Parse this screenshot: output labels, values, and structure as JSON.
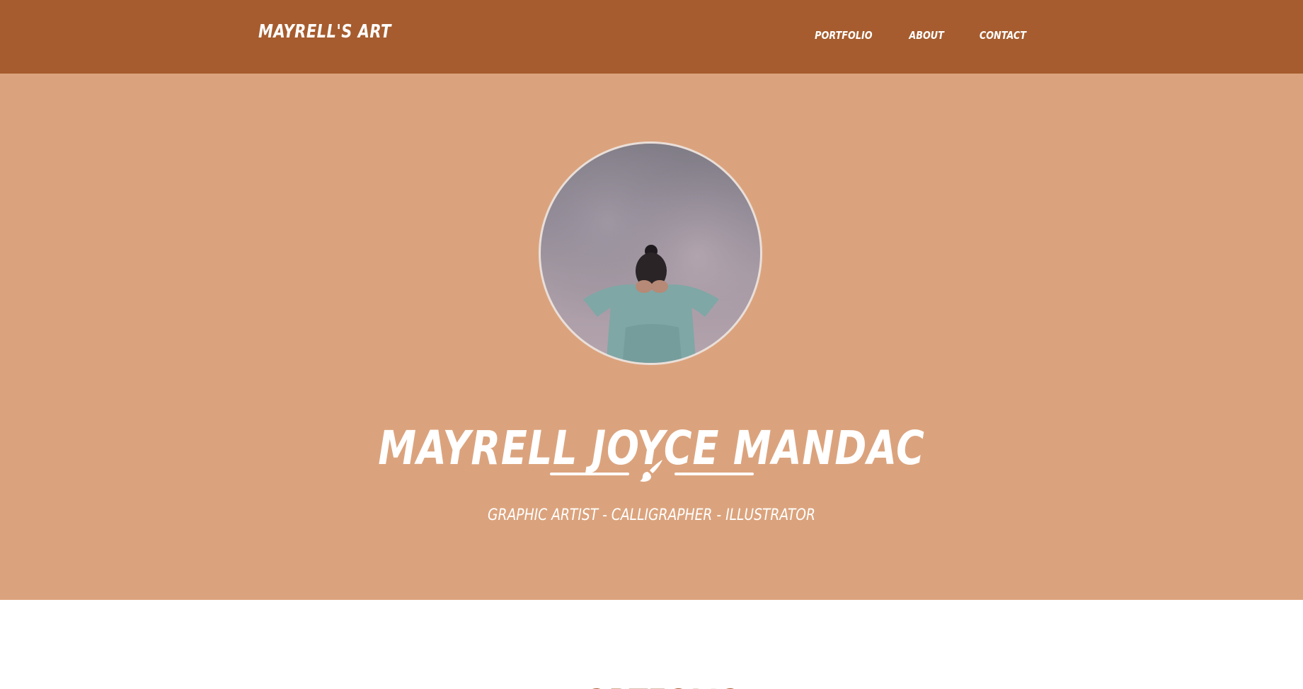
{
  "navbar": {
    "brand": "MAYRELL'S ART",
    "links": [
      "PORTFOLIO",
      "ABOUT",
      "CONTACT"
    ]
  },
  "hero": {
    "title": "MAYRELL JOYCE MANDAC",
    "subtitle": "GRAPHIC ARTIST - CALLIGRAPHER - ILLUSTRATOR",
    "divider_icon": "paintbrush-icon"
  },
  "portfolio": {
    "title": "PORTFOLIO"
  },
  "colors": {
    "navbar": "#a65c2e",
    "hero": "#dba37d",
    "accent": "#a65c2e",
    "text_light": "#ffffff"
  }
}
